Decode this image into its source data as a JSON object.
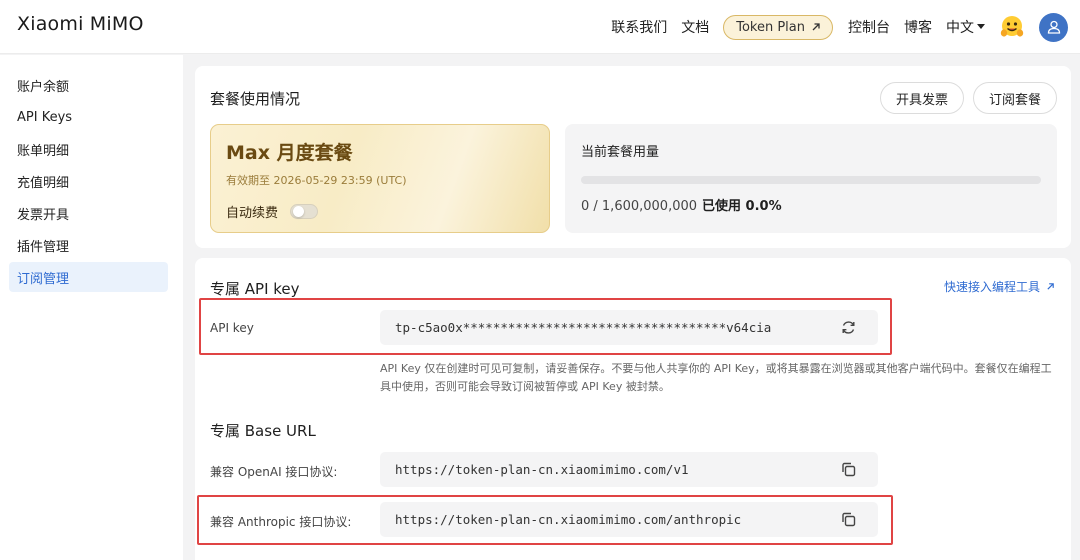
{
  "header": {
    "brand": "Xiaomi MiMO",
    "nav": {
      "contact": "联系我们",
      "docs": "文档",
      "token_plan": "Token Plan",
      "console": "控制台",
      "blog": "博客",
      "language": "中文"
    }
  },
  "sidebar": {
    "items": [
      {
        "label": "账户余额"
      },
      {
        "label": "API Keys"
      },
      {
        "label": "账单明细"
      },
      {
        "label": "充值明细"
      },
      {
        "label": "发票开具"
      },
      {
        "label": "插件管理"
      },
      {
        "label": "订阅管理",
        "active": true
      }
    ]
  },
  "plan_section": {
    "title": "套餐使用情况",
    "invoice_button": "开具发票",
    "subscribe_button": "订阅套餐",
    "plan_name": "Max 月度套餐",
    "expire": "有效期至 2026-05-29 23:59 (UTC)",
    "auto_renew_label": "自动续费",
    "auto_renew_on": false,
    "usage_title": "当前套餐用量",
    "usage_text": "0 / 1,600,000,000",
    "usage_used": "已使用 0.0%",
    "usage_fraction": 0.0
  },
  "api_section": {
    "title": "专属 API key",
    "quick_link": "快速接入编程工具",
    "key_label": "API key",
    "key_value": "tp-c5ao0x***********************************v64cia",
    "note": "API Key 仅在创建时可见可复制，请妥善保存。不要与他人共享你的 API Key，或将其暴露在浏览器或其他客户端代码中。套餐仅在编程工具中使用，否则可能会导致订阅被暂停或 API Key 被封禁。"
  },
  "base_url_section": {
    "title": "专属 Base URL",
    "openai_label": "兼容 OpenAI 接口协议:",
    "openai_url": "https://token-plan-cn.xiaomimimo.com/v1",
    "anthropic_label": "兼容 Anthropic 接口协议:",
    "anthropic_url": "https://token-plan-cn.xiaomimimo.com/anthropic"
  },
  "colors": {
    "accent": "#2f6bd1",
    "highlight_border": "#e04444",
    "plan_gold": "#6a4a12"
  },
  "icons": [
    "external-arrow-icon",
    "chevron-down-icon",
    "hugging-face-icon",
    "user-icon",
    "refresh-icon",
    "copy-icon"
  ]
}
